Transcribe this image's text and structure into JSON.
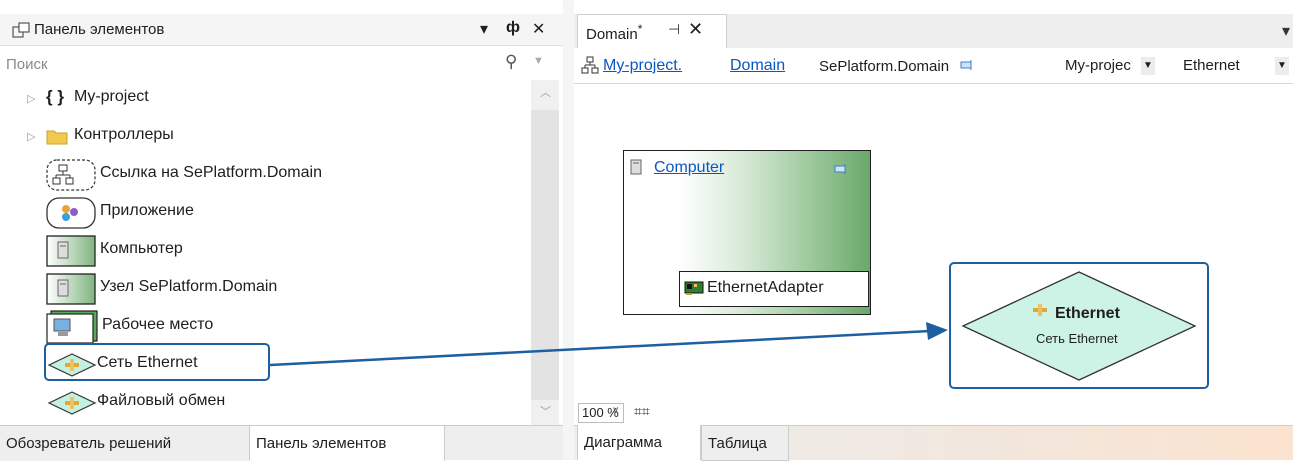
{
  "toolbox": {
    "title": "Панель элементов",
    "title_controls": {
      "dropdown": "▾",
      "pin": "ᵖ",
      "close": "✕"
    },
    "search": {
      "placeholder": "Поиск",
      "value": ""
    },
    "items": [
      {
        "label": "My-project",
        "icon": "braces-icon",
        "has_expander": true
      },
      {
        "label": "Контроллеры",
        "icon": "folder-icon",
        "has_expander": true
      },
      {
        "label": "Ссылка на SePlatform.Domain",
        "icon": "domain-link-icon"
      },
      {
        "label": "Приложение",
        "icon": "application-icon"
      },
      {
        "label": "Компьютер",
        "icon": "computer-icon"
      },
      {
        "label": "Узел SePlatform.Domain",
        "icon": "domain-node-icon"
      },
      {
        "label": "Рабочее место",
        "icon": "workstation-icon"
      },
      {
        "label": "Сеть Ethernet",
        "icon": "ethernet-network-icon",
        "highlighted": true
      },
      {
        "label": "Файловый обмен",
        "icon": "file-exchange-icon"
      }
    ],
    "bottom_tabs": [
      {
        "label": "Обозреватель решений",
        "active": false
      },
      {
        "label": "Панель элементов",
        "active": true
      }
    ]
  },
  "document": {
    "tab": {
      "label": "Domain",
      "modified_mark": "*",
      "pin": "⊣",
      "close": "✕"
    },
    "nav": {
      "link_project": "My-project.",
      "link_domain": "Domain",
      "type_text": "SePlatform.Domain",
      "combo_project": "My-projec",
      "combo_network": "Ethernet"
    },
    "diagram": {
      "computer": {
        "title": "Computer",
        "adapter": "EthernetAdapter"
      },
      "ethernet": {
        "title": "Ethernet",
        "subtitle": "Сеть Ethernet"
      }
    },
    "zoom": "100 %",
    "bottom_tabs": [
      {
        "label": "Диаграмма",
        "active": true
      },
      {
        "label": "Таблица",
        "active": false
      }
    ]
  },
  "colors": {
    "link": "#0b57c0",
    "selection_border": "#1d5fa0",
    "ethernet_fill": "#cdf3e6",
    "computer_gradient_end": "#6aa86a"
  }
}
